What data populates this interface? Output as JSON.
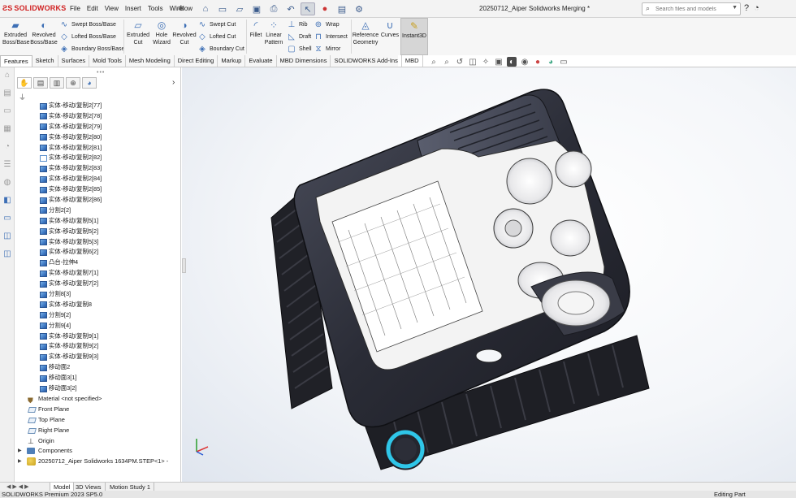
{
  "app": {
    "brand": "SOLIDWORKS",
    "document_title": "20250712_Aiper Solidworks Merging *"
  },
  "menu": [
    "File",
    "Edit",
    "View",
    "Insert",
    "Tools",
    "Window"
  ],
  "quick_access": [
    "home-icon",
    "new-doc-icon",
    "open-icon",
    "save-icon",
    "print-icon",
    "undo-icon",
    "select-icon",
    "traffic-light-icon",
    "file-props-icon",
    "options-icon"
  ],
  "search": {
    "placeholder": "Search files and models"
  },
  "ribbon": {
    "extruded_boss": "Extruded Boss/Base",
    "revolved_boss": "Revolved Boss/Base",
    "swept_boss": "Swept Boss/Base",
    "lofted_boss": "Lofted Boss/Base",
    "boundary_boss": "Boundary Boss/Base",
    "extruded_cut": "Extruded Cut",
    "hole_wizard": "Hole Wizard",
    "revolved_cut": "Revolved Cut",
    "swept_cut": "Swept Cut",
    "lofted_cut": "Lofted Cut",
    "boundary_cut": "Boundary Cut",
    "fillet": "Fillet",
    "linear_pattern": "Linear Pattern",
    "rib": "Rib",
    "draft": "Draft",
    "shell": "Shell",
    "wrap": "Wrap",
    "intersect": "Intersect",
    "mirror": "Mirror",
    "reference_geometry": "Reference Geometry",
    "curves": "Curves",
    "instant3d": "Instant3D"
  },
  "tabs": [
    "Features",
    "Sketch",
    "Surfaces",
    "Mold Tools",
    "Mesh Modeling",
    "Direct Editing",
    "Markup",
    "Evaluate",
    "MBD Dimensions",
    "SOLIDWORKS Add-Ins",
    "MBD"
  ],
  "active_tab": "Features",
  "tree": {
    "features": [
      "实体-移动/复制2[77]",
      "实体-移动/复制2[78]",
      "实体-移动/复制2[79]",
      "实体-移动/复制2[80]",
      "实体-移动/复制2[81]",
      "实体-移动/复制2[82]",
      "实体-移动/复制2[83]",
      "实体-移动/复制2[84]",
      "实体-移动/复制2[85]",
      "实体-移动/复制2[86]",
      "分割2[2]",
      "实体-移动/复制5[1]",
      "实体-移动/复制5[2]",
      "实体-移动/复制5[3]",
      "实体-移动/复制6[2]",
      "凸台-拉伸4",
      "实体-移动/复制7[1]",
      "实体-移动/复制7[2]",
      "分割8[3]",
      "实体-移动/复制8",
      "分割9[2]",
      "分割9[4]",
      "实体-移动/复制9[1]",
      "实体-移动/复制9[2]",
      "实体-移动/复制9[3]",
      "移动面2",
      "移动面3[1]",
      "移动面3[2]"
    ],
    "material": "Material <not specified>",
    "planes": [
      "Front Plane",
      "Top Plane",
      "Right Plane"
    ],
    "origin": "Origin",
    "components": "Components",
    "assembly": "20250712_Aiper Solidworks 1634PM.STEP<1> -"
  },
  "bottom_tabs": [
    "Model",
    "3D Views",
    "Motion Study 1"
  ],
  "status": {
    "left": "SOLIDWORKS Premium 2023 SP5.0",
    "right": "Editing Part"
  },
  "colors": {
    "accent": "#3d6fb5",
    "brand": "#d02020",
    "ring_glow": "#2fc6e8"
  }
}
